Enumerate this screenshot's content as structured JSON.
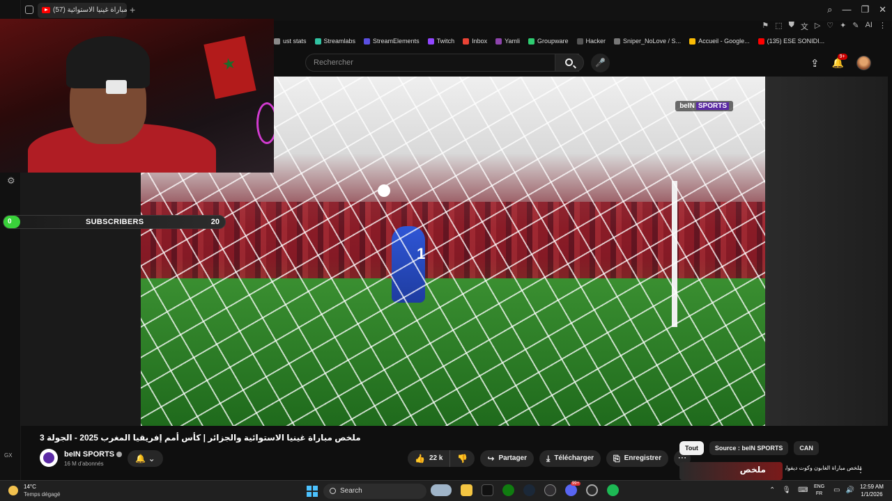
{
  "browser": {
    "tab_title": "(57) ملخص مباراة غينيا الاستوائية",
    "new_tab": "+",
    "window_controls": [
      "⌕",
      "—",
      "❐",
      "✕"
    ],
    "extensions": [
      "⚑",
      "⬚",
      "⛊",
      "文",
      "▷",
      "♡",
      "✦",
      "✎",
      "AI",
      "⋮"
    ]
  },
  "bookmarks": [
    {
      "label": "ust stats",
      "color": "#8a8a8a"
    },
    {
      "label": "Streamlabs",
      "color": "#31c3a2"
    },
    {
      "label": "StreamElements",
      "color": "#5a4fe0"
    },
    {
      "label": "Twitch",
      "color": "#9146ff"
    },
    {
      "label": "Inbox",
      "color": "#ea4335"
    },
    {
      "label": "Yamli",
      "color": "#8e44ad"
    },
    {
      "label": "Groupware",
      "color": "#2ecc71"
    },
    {
      "label": "Hacker",
      "color": "#555555"
    },
    {
      "label": "Sniper_NoLove / S...",
      "color": "#777777"
    },
    {
      "label": "Accueil - Google...",
      "color": "#fbbc05"
    },
    {
      "label": "(135) ESE SONIDI...",
      "color": "#ff0000"
    }
  ],
  "youtube": {
    "search_placeholder": "Rechercher",
    "notification_count": "9+"
  },
  "overlay": {
    "subscribers_label": "SUBSCRIBERS",
    "subscribers_current": "0",
    "subscribers_goal": "20"
  },
  "video": {
    "broadcaster_logo": "beIN",
    "broadcaster_logo_suffix": "SPORTS",
    "keeper_number": "1",
    "title": "ملخص مباراة غينيا الاستوائية والجزائر | كأس أمم إفريقيا المغرب 2025 - الجولة 3"
  },
  "channel": {
    "name": "beIN SPORTS",
    "subscribers": "16 M d'abonnés"
  },
  "actions": {
    "likes": "22 k",
    "share": "Partager",
    "download": "Télécharger",
    "save": "Enregistrer"
  },
  "chips": [
    "Tout",
    "Source : beIN SPORTS",
    "CAN"
  ],
  "recommendation": {
    "thumb_text": "ملخص",
    "title": "ملخص مباراة الغابون وكوت ديفوار | كأس أمم إفريقيا المغرب"
  },
  "taskbar": {
    "temperature": "14°C",
    "weather": "Temps dégagé",
    "search": "Search",
    "lang_top": "ENG",
    "lang_bottom": "FR",
    "time": "12:59 AM",
    "date": "1/1/2026",
    "notif_badge": "99+"
  },
  "sidebar": {
    "gx_label": "GX"
  }
}
